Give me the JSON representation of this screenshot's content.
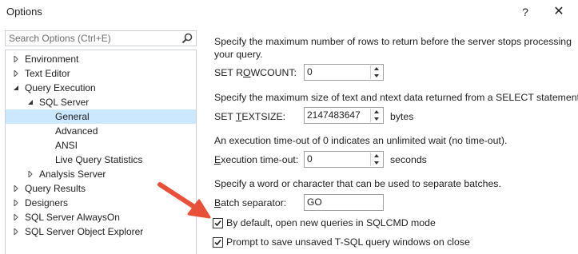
{
  "window": {
    "title": "Options",
    "help_glyph": "?",
    "close_glyph": "✕"
  },
  "search": {
    "placeholder": "Search Options (Ctrl+E)",
    "value": ""
  },
  "tree": {
    "items": [
      {
        "label": "Environment",
        "state": "collapsed"
      },
      {
        "label": "Text Editor",
        "state": "collapsed"
      },
      {
        "label": "Query Execution",
        "state": "expanded"
      },
      {
        "label": "SQL Server",
        "state": "expanded"
      },
      {
        "label": "General",
        "state": "leaf",
        "selected": true
      },
      {
        "label": "Advanced",
        "state": "leaf"
      },
      {
        "label": "ANSI",
        "state": "leaf"
      },
      {
        "label": "Live Query Statistics",
        "state": "leaf"
      },
      {
        "label": "Analysis Server",
        "state": "collapsed"
      },
      {
        "label": "Query Results",
        "state": "collapsed"
      },
      {
        "label": "Designers",
        "state": "collapsed"
      },
      {
        "label": "SQL Server AlwaysOn",
        "state": "collapsed"
      },
      {
        "label": "SQL Server Object Explorer",
        "state": "collapsed"
      }
    ]
  },
  "general": {
    "rowcount_desc_1": "Specify the maximum number of rows to return before the server stops processing",
    "rowcount_desc_2": "your query.",
    "rowcount_label_pre": "SET R",
    "rowcount_label_u": "O",
    "rowcount_label_post": "WCOUNT:",
    "rowcount_value": "0",
    "textsize_desc": "Specify the maximum size of text and ntext data returned from a SELECT statement.",
    "textsize_label_pre": "SET ",
    "textsize_label_u": "T",
    "textsize_label_post": "EXTSIZE:",
    "textsize_value": "2147483647",
    "textsize_unit": "bytes",
    "timeout_desc": "An execution time-out of 0 indicates an unlimited wait (no time-out).",
    "timeout_label_u": "E",
    "timeout_label_post": "xecution time-out:",
    "timeout_value": "0",
    "timeout_unit": "seconds",
    "batch_desc": "Specify a word or character that can be used to separate batches.",
    "batch_label_u": "B",
    "batch_label_post": "atch separator:",
    "batch_value": "GO",
    "sqlcmd_label": "By default, open new queries in SQLCMD mode",
    "sqlcmd_checked": true,
    "prompt_save_label": "Prompt to save unsaved T-SQL query windows on close",
    "prompt_save_checked": true
  },
  "colors": {
    "selection": "#cce8ff",
    "arrow": "#e8503a",
    "border": "#cccedb"
  }
}
